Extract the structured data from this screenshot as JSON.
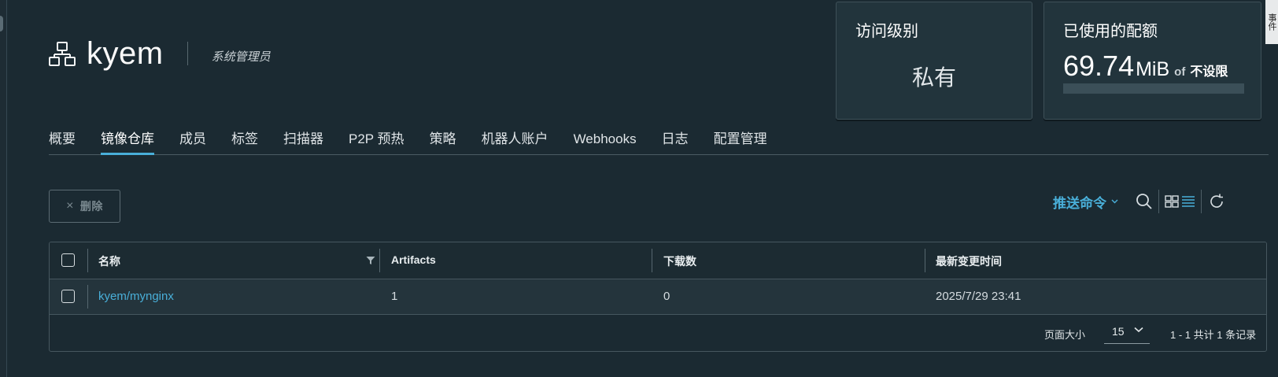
{
  "project": {
    "name": "kyem",
    "role": "系统管理员"
  },
  "cards": {
    "access": {
      "title": "访问级别",
      "value": "私有"
    },
    "quota": {
      "title": "已使用的配额",
      "used_number": "69.74",
      "used_unit": "MiB",
      "of_label": "of",
      "limit_label": "不设限",
      "usage_fraction": 0.0
    }
  },
  "side_tab": {
    "label": "事件"
  },
  "tabs": [
    {
      "label": "概要",
      "active": false
    },
    {
      "label": "镜像仓库",
      "active": true
    },
    {
      "label": "成员",
      "active": false
    },
    {
      "label": "标签",
      "active": false
    },
    {
      "label": "扫描器",
      "active": false
    },
    {
      "label": "P2P 预热",
      "active": false
    },
    {
      "label": "策略",
      "active": false
    },
    {
      "label": "机器人账户",
      "active": false
    },
    {
      "label": "Webhooks",
      "active": false
    },
    {
      "label": "日志",
      "active": false
    },
    {
      "label": "配置管理",
      "active": false
    }
  ],
  "toolbar": {
    "delete_label": "删除",
    "delete_icon": "×",
    "push_command_label": "推送命令"
  },
  "table": {
    "columns": [
      "名称",
      "Artifacts",
      "下载数",
      "最新变更时间"
    ],
    "rows": [
      {
        "name": "kyem/mynginx",
        "artifacts": "1",
        "pulls": "0",
        "updated": "2025/7/29 23:41"
      }
    ]
  },
  "pagination": {
    "page_size_label": "页面大小",
    "page_size": "15",
    "summary": "1 - 1 共计 1 条记录"
  },
  "colors": {
    "background": "#1b2a32",
    "accent": "#49afd9",
    "card_bg": "#22343c"
  }
}
